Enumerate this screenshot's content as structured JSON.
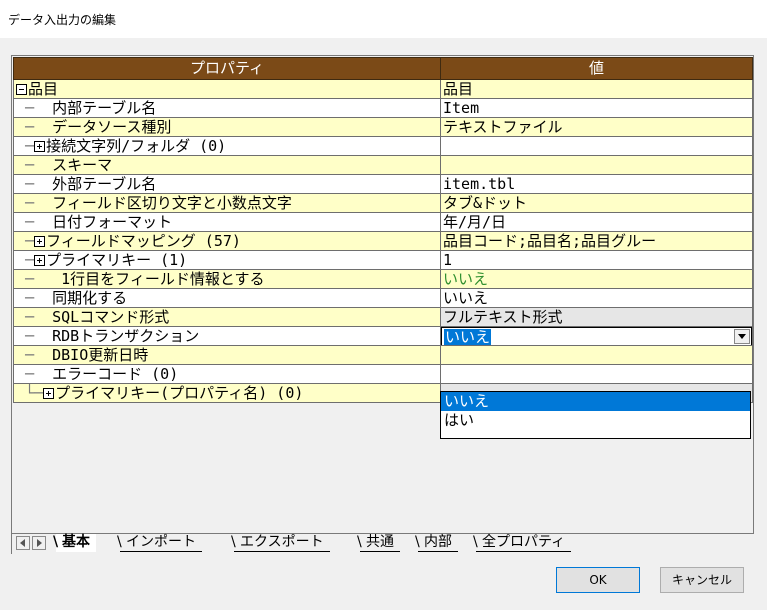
{
  "window": {
    "title": "データ入出力の編集"
  },
  "grid": {
    "headers": {
      "property": "プロパティ",
      "value": "値"
    },
    "rows": [
      {
        "label": "品目",
        "value": "品目"
      },
      {
        "label": "内部テーブル名",
        "value": "Item"
      },
      {
        "label": "データソース種別",
        "value": "テキストファイル"
      },
      {
        "label": "接続文字列/フォルダ (0)",
        "value": ""
      },
      {
        "label": "スキーマ",
        "value": ""
      },
      {
        "label": "外部テーブル名",
        "value": "item.tbl"
      },
      {
        "label": "フィールド区切り文字と小数点文字",
        "value": "タブ&ドット"
      },
      {
        "label": "日付フォーマット",
        "value": "年/月/日"
      },
      {
        "label": "フィールドマッピング (57)",
        "value": "品目コード;品目名;品目グルー"
      },
      {
        "label": "プライマリキー (1)",
        "value": "1"
      },
      {
        "label": "1行目をフィールド情報とする",
        "value": "いいえ"
      },
      {
        "label": "同期化する",
        "value": "いいえ"
      },
      {
        "label": "SQLコマンド形式",
        "value": "フルテキスト形式"
      },
      {
        "label": "RDBトランザクション",
        "value": "いいえ"
      },
      {
        "label": "DBIO更新日時",
        "value": ""
      },
      {
        "label": "エラーコード (0)",
        "value": ""
      },
      {
        "label": "プライマリキー(プロパティ名) (0)",
        "value": ""
      }
    ]
  },
  "dropdown": {
    "options": [
      "いいえ",
      "はい"
    ],
    "selected": "いいえ"
  },
  "tabs": [
    "基本",
    "インポート",
    "エクスポート",
    "共通",
    "内部",
    "全プロパティ"
  ],
  "buttons": {
    "ok": "OK",
    "cancel": "キャンセル"
  },
  "colors": {
    "header_bg": "#7b4a17",
    "row_yellow": "#ffffc8",
    "selection": "#0078d7",
    "green_text": "#2f8f2f"
  }
}
